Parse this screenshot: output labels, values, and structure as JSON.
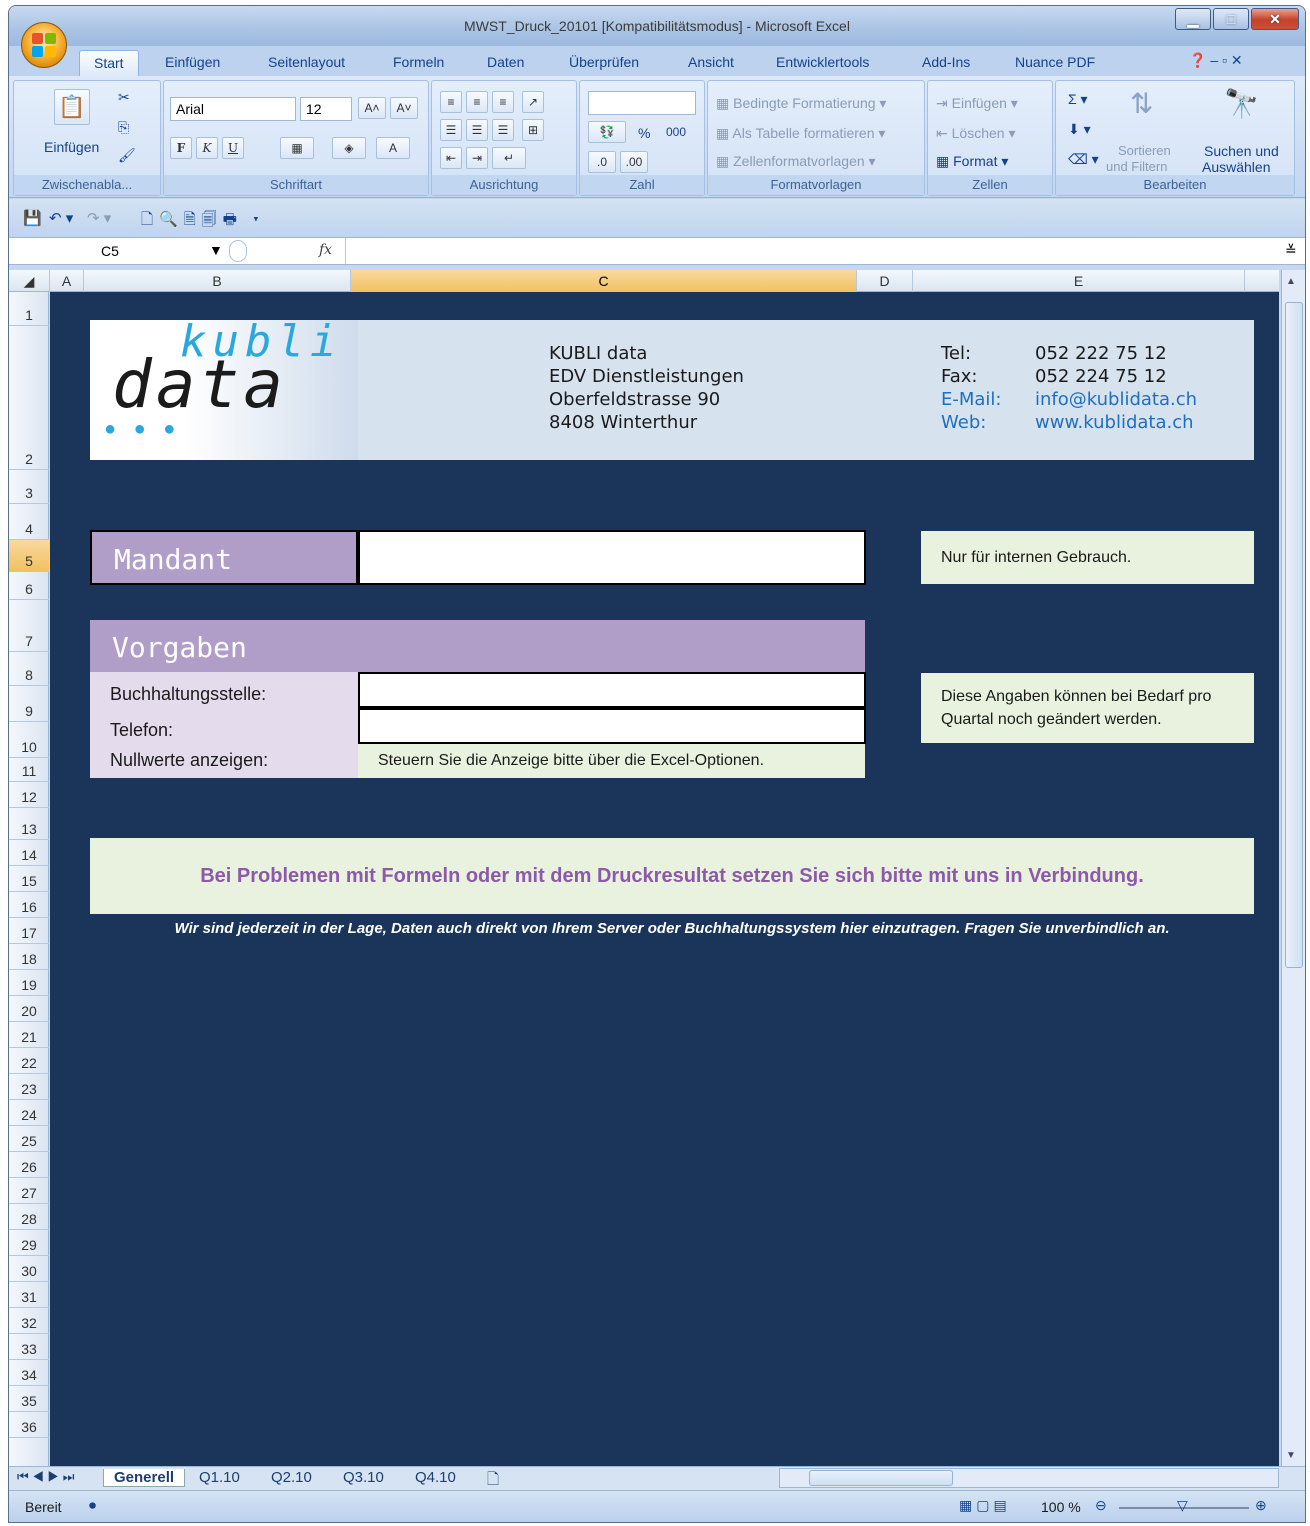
{
  "window": {
    "title": "MWST_Druck_20101  [Kompatibilitätsmodus]  -  Microsoft Excel"
  },
  "ribbon_tabs": [
    "Start",
    "Einfügen",
    "Seitenlayout",
    "Formeln",
    "Daten",
    "Überprüfen",
    "Ansicht",
    "Entwicklertools",
    "Add-Ins",
    "Nuance PDF"
  ],
  "ribbon": {
    "clipboard": {
      "paste": "Einfügen",
      "label": "Zwischenabla..."
    },
    "font": {
      "name": "Arial",
      "size": "12",
      "label": "Schriftart",
      "bold": "F",
      "italic": "K",
      "underline": "U"
    },
    "alignment": {
      "label": "Ausrichtung"
    },
    "number": {
      "label": "Zahl",
      "percent": "%",
      "thousands": "000"
    },
    "styles": {
      "conditional": "Bedingte Formatierung",
      "table": "Als Tabelle formatieren",
      "cell": "Zellenformatvorlagen",
      "label": "Formatvorlagen"
    },
    "cells": {
      "insert": "Einfügen",
      "delete": "Löschen",
      "format": "Format",
      "label": "Zellen"
    },
    "editing": {
      "sort1": "Sortieren",
      "sort2": "und Filtern",
      "find1": "Suchen und",
      "find2": "Auswählen",
      "label": "Bearbeiten"
    }
  },
  "formula_bar": {
    "name_box": "C5",
    "fx": "fx",
    "value": ""
  },
  "columns": [
    "A",
    "B",
    "C",
    "D",
    "E"
  ],
  "rows": [
    "1",
    "2",
    "3",
    "4",
    "5",
    "6",
    "7",
    "8",
    "9",
    "10",
    "11",
    "12",
    "13",
    "14",
    "15",
    "16",
    "17",
    "18",
    "19",
    "20",
    "21",
    "22",
    "23",
    "24",
    "25",
    "26",
    "27",
    "28",
    "29",
    "30",
    "31",
    "32",
    "33",
    "34",
    "35",
    "36"
  ],
  "company": {
    "logo_top": "kubli",
    "logo_bottom": "data",
    "name": "KUBLI data",
    "line2": "EDV Dienstleistungen",
    "street": "Oberfeldstrasse 90",
    "city": "8408 Winterthur",
    "tel_label": "Tel:",
    "tel": "052 222 75 12",
    "fax_label": "Fax:",
    "fax": "052 224 75 12",
    "mail_label": "E-Mail:",
    "mail": "info@kublidata.ch",
    "web_label": "Web:",
    "web": "www.kublidata.ch"
  },
  "mandant": {
    "label": "Mandant",
    "value": "",
    "note": "Nur für internen Gebrauch."
  },
  "vorgaben": {
    "label": "Vorgaben",
    "buchhaltung_label": "Buchhaltungsstelle:",
    "buchhaltung_value": "",
    "telefon_label": "Telefon:",
    "telefon_value": "",
    "nullwerte_label": "Nullwerte anzeigen:",
    "nullwerte_value": "Steuern Sie die Anzeige bitte über die Excel-Optionen.",
    "note": "Diese Angaben können bei Bedarf pro Quartal noch geändert werden."
  },
  "problem_banner": "Bei Problemen mit Formeln oder mit dem Druckresultat setzen Sie sich bitte mit uns in Verbindung.",
  "footer_note": "Wir sind jederzeit in der Lage, Daten auch direkt von Ihrem Server oder Buchhaltungssystem hier einzutragen. Fragen Sie unverbindlich an.",
  "sheet_tabs": [
    "Generell",
    "Q1.10",
    "Q2.10",
    "Q3.10",
    "Q4.10"
  ],
  "status": {
    "ready": "Bereit",
    "zoom": "100 %"
  }
}
